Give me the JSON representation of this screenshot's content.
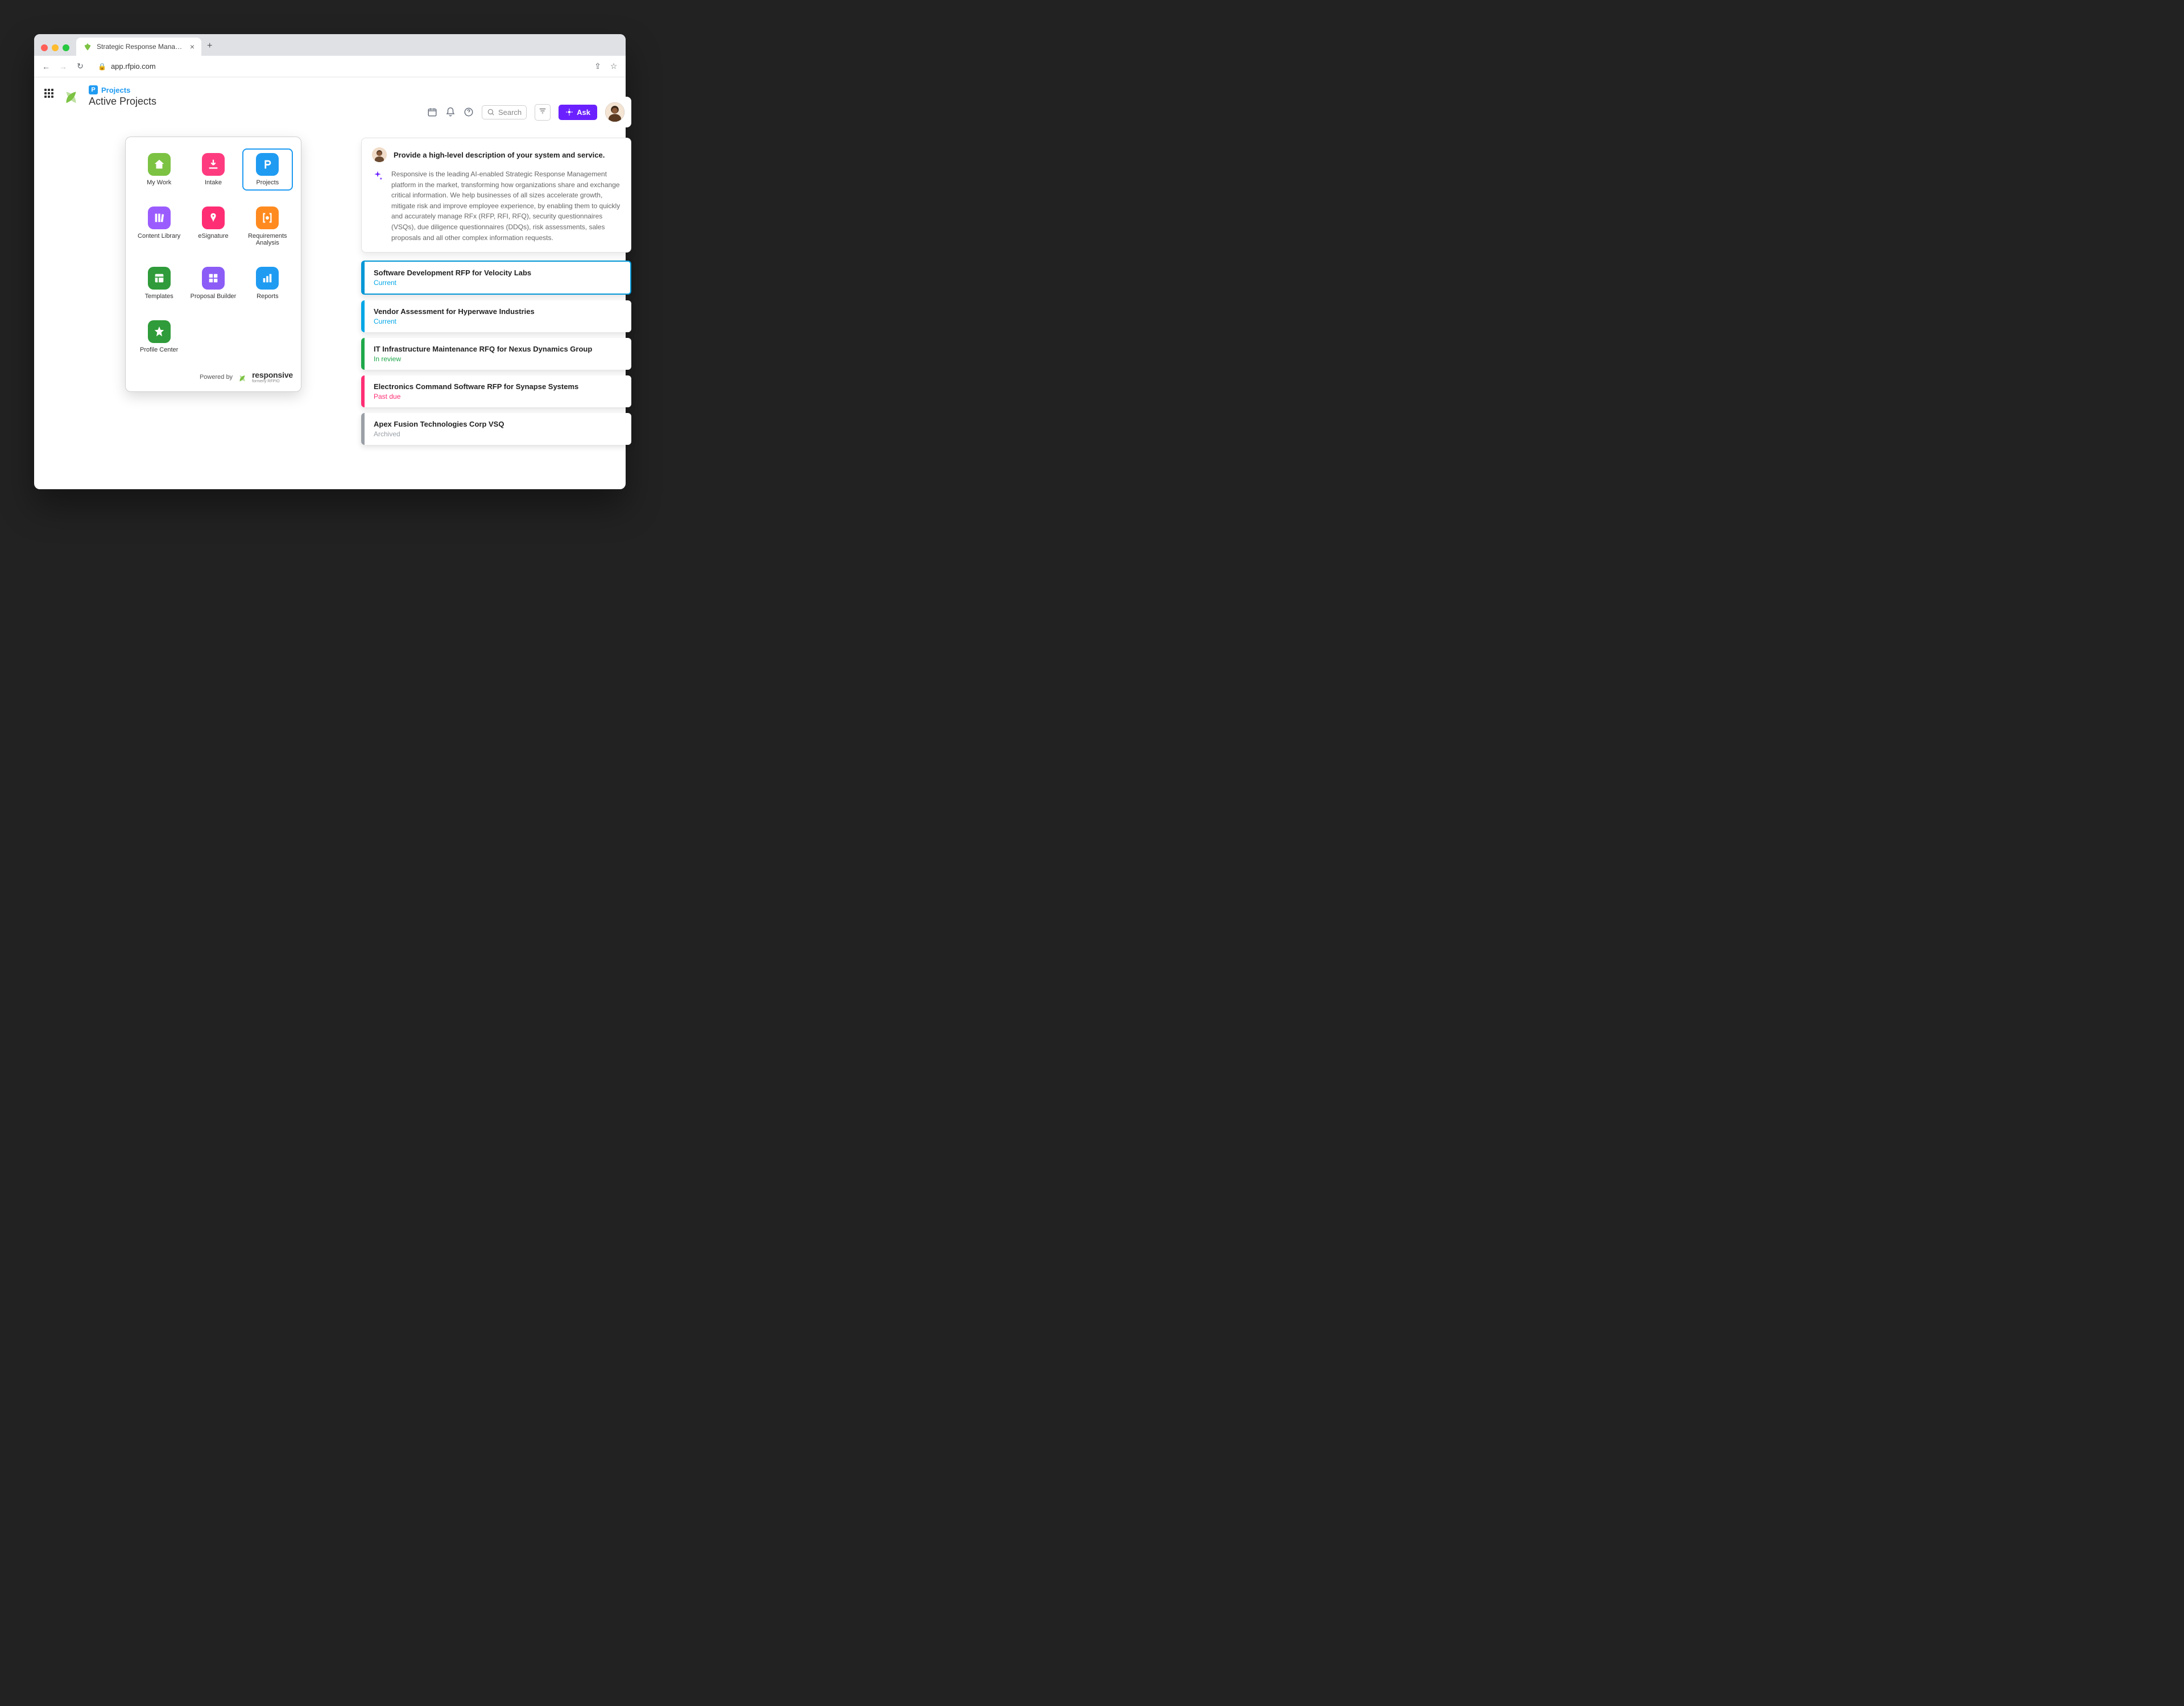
{
  "browser": {
    "tab_title": "Strategic Response Managem",
    "url_host": "app.rfpio.com"
  },
  "header": {
    "breadcrumb_label": "Projects",
    "page_title": "Active Projects",
    "search_placeholder": "Search",
    "ask_label": "Ask"
  },
  "launcher": {
    "items": [
      {
        "label": "My Work",
        "icon": "home",
        "bg": "#7cc243"
      },
      {
        "label": "Intake",
        "icon": "download",
        "bg": "#ff3b7f"
      },
      {
        "label": "Projects",
        "icon": "p",
        "bg": "#1f9bf2",
        "selected": true
      },
      {
        "label": "Content Library",
        "icon": "books",
        "bg": "#9b5cff"
      },
      {
        "label": "eSignature",
        "icon": "pen",
        "bg": "#ff2d74"
      },
      {
        "label": "Requirements Analysis",
        "icon": "brackets",
        "bg": "#ff8a1f"
      },
      {
        "label": "Templates",
        "icon": "template",
        "bg": "#2f9b3a"
      },
      {
        "label": "Proposal Builder",
        "icon": "grid",
        "bg": "#8b5cf6"
      },
      {
        "label": "Reports",
        "icon": "bars",
        "bg": "#1f9bf2"
      },
      {
        "label": "Profile Center",
        "icon": "star",
        "bg": "#2f9b3a"
      }
    ],
    "powered_by_label": "Powered by",
    "brand_name": "responsive",
    "brand_sub": "formerly RFPIO"
  },
  "assistant": {
    "question": "Provide a high-level description of your system and service.",
    "answer": "Responsive is the leading AI-enabled Strategic Response Management platform in the market, transforming how organizations share and exchange critical information. We help businesses of all sizes accelerate growth, mitigate risk and improve employee experience, by enabling them to quickly and accurately manage RFx (RFP, RFI, RFQ), security questionnaires (VSQs), due diligence questionnaires (DDQs), risk assessments, sales proposals and all other complex information requests."
  },
  "projects": [
    {
      "title": "Software Development RFP for Velocity Labs",
      "status": "Current",
      "accent": "#0097d6",
      "status_color": "#00a7e6",
      "selected": true
    },
    {
      "title": "Vendor Assessment for Hyperwave Industries",
      "status": "Current",
      "accent": "#00a7e6",
      "status_color": "#00a7e6"
    },
    {
      "title": "IT Infrastructure Maintenance RFQ for Nexus Dynamics Group",
      "status": "In review",
      "accent": "#1fa84a",
      "status_color": "#1fa84a"
    },
    {
      "title": "Electronics Command Software RFP for Synapse Systems",
      "status": "Past due",
      "accent": "#ff2d74",
      "status_color": "#ff2d74"
    },
    {
      "title": "Apex Fusion Technologies Corp VSQ",
      "status": "Archived",
      "accent": "#9aa0a6",
      "status_color": "#9aa0a6"
    }
  ]
}
